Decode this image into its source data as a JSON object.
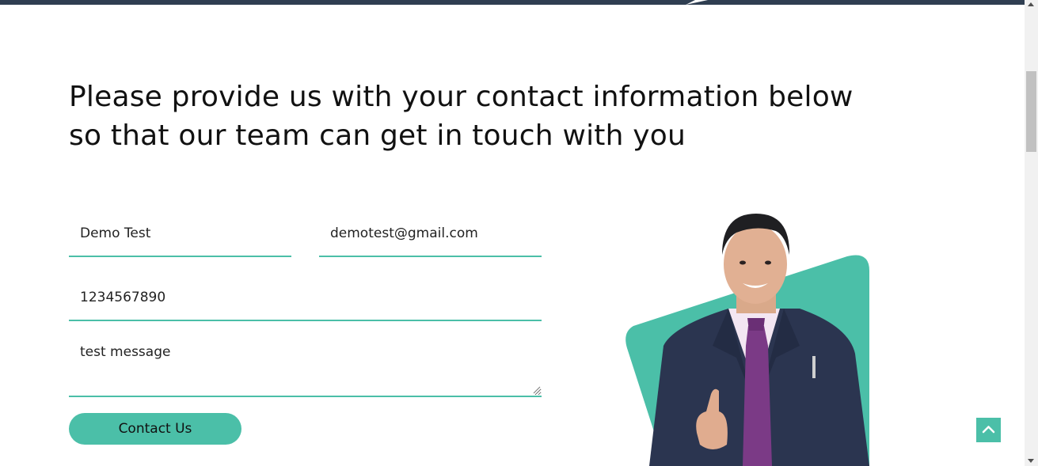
{
  "heading": {
    "line1": "Please provide us with your contact information below",
    "line2": "so that our team can get in touch with you"
  },
  "form": {
    "name_value": "Demo Test",
    "email_value": "demotest@gmail.com",
    "phone_value": "1234567890",
    "message_value": "test message",
    "submit_label": "Contact Us"
  },
  "colors": {
    "accent": "#4bbfa8",
    "top_bar": "#2f3e51",
    "text": "#111111"
  },
  "icons": {
    "back_to_top": "chevron-up-icon",
    "resize": "resize-grip-icon"
  }
}
